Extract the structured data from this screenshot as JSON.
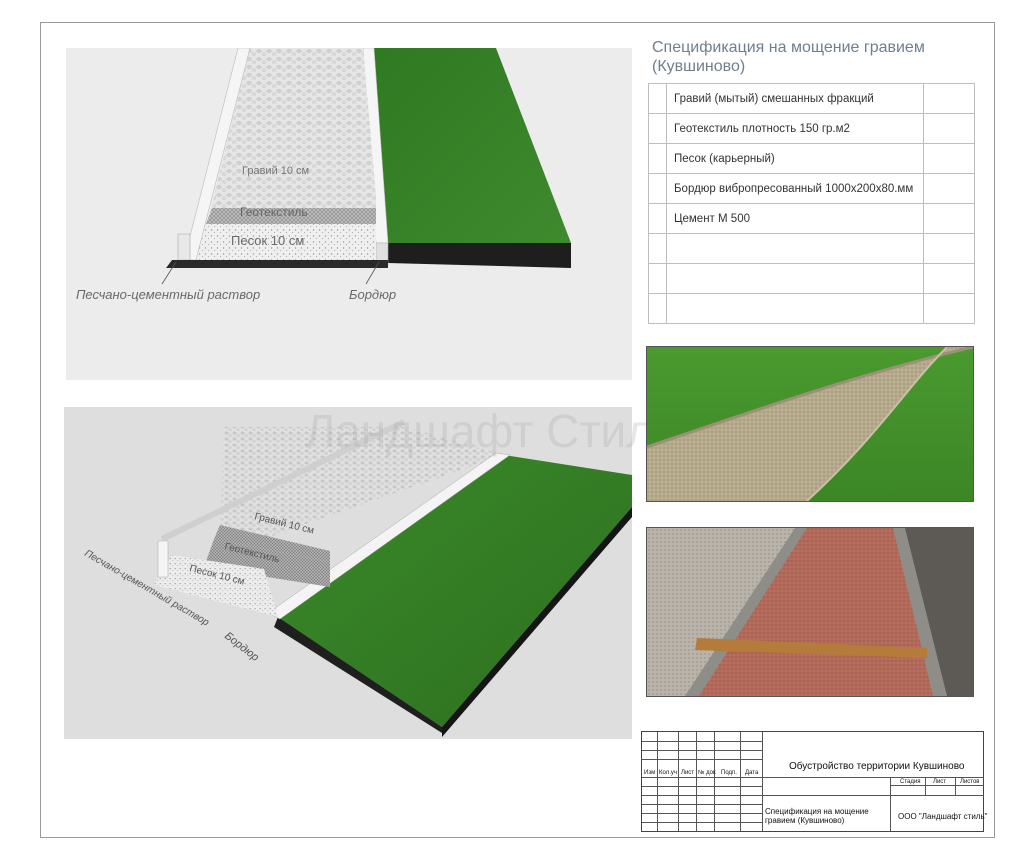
{
  "watermark": "Ландшафт Стиль",
  "diagram_top": {
    "layer_gravel": "Гравий 10 см",
    "layer_geotextile": "Геотекстиль",
    "layer_sand": "Песок 10 см",
    "label_mortar": "Песчано-цементный раствор",
    "label_curb": "Бордюр"
  },
  "diagram_bottom": {
    "layer_gravel": "Гравий 10 см",
    "layer_geotextile": "Геотекстиль",
    "layer_sand": "Песок 10 см",
    "label_mortar": "Песчано-цементный раствор",
    "label_curb": "Бордюр"
  },
  "spec": {
    "title": "Спецификация на мощение гравием (Кувшиново)",
    "rows": [
      "Гравий (мытый) смешанных фракций",
      "Геотекстиль плотность 150 гр.м2",
      "Песок (карьерный)",
      "Бордюр вибропресованный 1000х200х80.мм",
      "Цемент М 500",
      "",
      "",
      ""
    ]
  },
  "title_block": {
    "columns": [
      "Изм",
      "Кол.уч",
      "Лист",
      "№ док",
      "Подп.",
      "Дата"
    ],
    "project": "Обустройство территории Кувшиново",
    "stage_headers": [
      "Стадия",
      "Лист",
      "Листов"
    ],
    "sheet_name": "Спецификация на мощение гравием (Кувшиново)",
    "company": "ООО \"Ландшафт стиль\""
  },
  "colors": {
    "grass": "#3c7a28",
    "gravel": "#d8d8d8",
    "spec_title": "#6f7f8d"
  }
}
